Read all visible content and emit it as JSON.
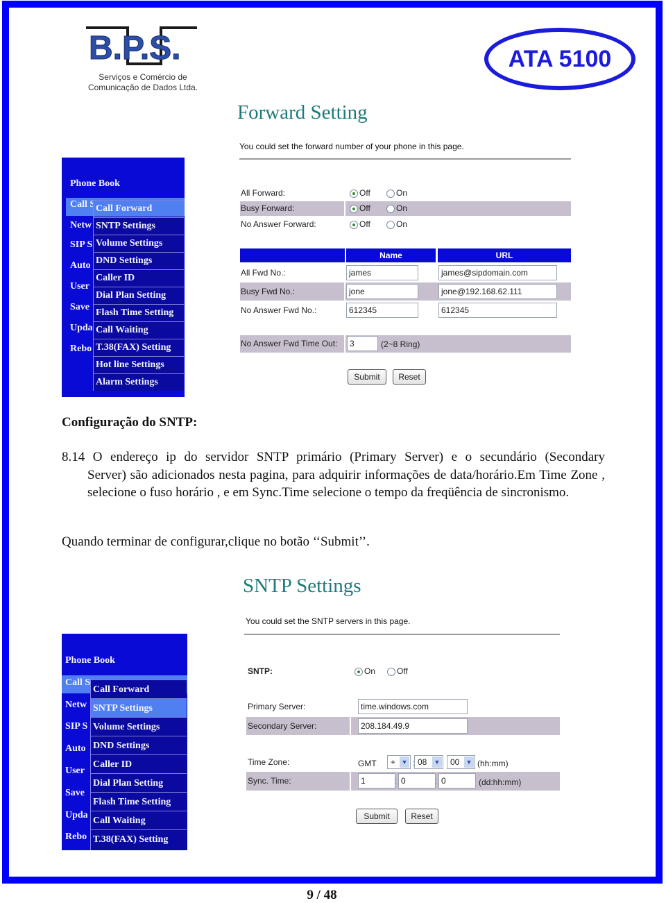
{
  "logos": {
    "bps": {
      "letters": "B.P.S.",
      "line1": "Serviços e Comércio de",
      "line2": "Comunicação de Dados Ltda."
    },
    "ata": {
      "text": "ATA 5100"
    }
  },
  "colors": {
    "frame": "#0000ff",
    "menu": "#0a0ad6",
    "menu_highlight": "#4f7ff0",
    "title": "#1e7a78",
    "row_shade": "#c7bfcd"
  },
  "forward_screen": {
    "title": "Forward Setting",
    "description": "You could set the forward number of your phone in this page.",
    "menu": {
      "main_items": [
        "Phone Book",
        "Call S",
        "Netw",
        "SIP S",
        "Auto",
        "User",
        "Save",
        "Upda",
        "Rebo"
      ],
      "sub_items": [
        "Call Forward",
        "SNTP Settings",
        "Volume Settings",
        "DND Settings",
        "Caller ID",
        "Dial Plan Setting",
        "Flash Time Setting",
        "Call Waiting",
        "T.38(FAX) Setting",
        "Hot line Settings",
        "Alarm Settings"
      ],
      "active_sub": "Call Forward"
    },
    "radio_rows": [
      {
        "label": "All Forward:",
        "off": "Off",
        "on": "On",
        "selected": "Off"
      },
      {
        "label": "Busy Forward:",
        "off": "Off",
        "on": "On",
        "selected": "Off"
      },
      {
        "label": "No Answer Forward:",
        "off": "Off",
        "on": "On",
        "selected": "Off"
      }
    ],
    "table": {
      "headers": [
        "",
        "Name",
        "URL"
      ],
      "rows": [
        {
          "label": "All Fwd No.:",
          "name": "james",
          "url": "james@sipdomain.com"
        },
        {
          "label": "Busy Fwd No.:",
          "name": "jone",
          "url": "jone@192.168.62.111"
        },
        {
          "label": "No Answer Fwd No.:",
          "name": "612345",
          "url": "612345"
        }
      ]
    },
    "timeout": {
      "label": "No Answer Fwd Time Out:",
      "value": "3",
      "hint": "(2~8 Ring)"
    },
    "submit": "Submit",
    "reset": "Reset"
  },
  "document": {
    "heading": "Configuração do SNTP:",
    "paragraph_lead": "8.14 O endereço ip do servidor SNTP primário (Primary Server) e o secundário (Secondary",
    "paragraph_rest": "Server) são adicionados nesta pagina, para adquirir informações de data/horário.Em Time Zone , selecione o fuso horário , e em Sync.Time selecione o tempo da freqüência de sincronismo.",
    "closing": "Quando terminar de configurar,clique no botão ‘‘Submit’’."
  },
  "sntp_screen": {
    "title": "SNTP Settings",
    "description": "You could set the SNTP servers in this page.",
    "menu": {
      "main_items": [
        "Phone Book",
        "Call S",
        "Netw",
        "SIP S",
        "Auto",
        "User",
        "Save",
        "Upda",
        "Rebo"
      ],
      "sub_items": [
        "Call Forward",
        "SNTP Settings",
        "Volume Settings",
        "DND Settings",
        "Caller ID",
        "Dial Plan Setting",
        "Flash Time Setting",
        "Call Waiting",
        "T.38(FAX) Setting"
      ],
      "active_sub": "SNTP Settings"
    },
    "sntp": {
      "label": "SNTP:",
      "on": "On",
      "off": "Off",
      "selected": "On"
    },
    "primary": {
      "label": "Primary Server:",
      "value": "time.windows.com"
    },
    "secondary": {
      "label": "Secondary Server:",
      "value": "208.184.49.9"
    },
    "timezone": {
      "label": "Time Zone:",
      "prefix": "GMT",
      "sign": "+",
      "hours": "08",
      "minutes": "00",
      "hint": "(hh:mm)"
    },
    "sync": {
      "label": "Sync. Time:",
      "days": "1",
      "hours": "0",
      "minutes": "0",
      "hint": "(dd:hh:mm)"
    },
    "submit": "Submit",
    "reset": "Reset"
  },
  "footer": {
    "page": "9 / 48"
  }
}
